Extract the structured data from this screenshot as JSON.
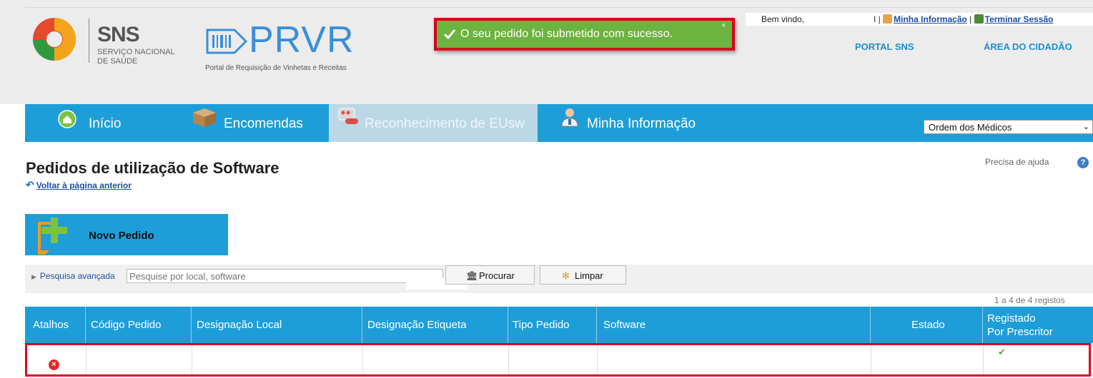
{
  "header": {
    "sns_title": "SNS",
    "sns_sub1": "SERVIÇO NACIONAL",
    "sns_sub2": "DE SAÚDE",
    "prvr_title": "PRVR",
    "prvr_subtitle": "Portal de Requisição de Vinhetas e Receitas",
    "welcome": "Bem vindo,",
    "separator": "I |",
    "my_info_link": "Minha Informação",
    "pipe": "|",
    "logout_link": "Terminar Sessão",
    "portal_sns": "PORTAL SNS",
    "area_cidadao": "ÁREA DO CIDADÃO"
  },
  "toast": {
    "message": "O seu pedido foi submetido com sucesso.",
    "close": "×",
    "success_color": "#6cb33f"
  },
  "nav": {
    "items": [
      {
        "label": "Início",
        "icon": "home-icon"
      },
      {
        "label": "Encomendas",
        "icon": "box-icon"
      },
      {
        "label": "Reconhecimento de EUsw",
        "icon": "pills-icon"
      },
      {
        "label": "Minha Informação",
        "icon": "doctor-icon"
      }
    ],
    "org_select": "Ordem dos Médicos",
    "accent": "#1e9ed8"
  },
  "page": {
    "title": "Pedidos de utilização de Software",
    "back_link": "Voltar à página anterior",
    "help": "Precisa de ajuda",
    "new_button": "Novo Pedido"
  },
  "search": {
    "advanced_link": "Pesquisa avançada",
    "placeholder": "Pesquise por local, software",
    "search_button": "Procurar",
    "clear_button": "Limpar",
    "count": "1 a 4 de 4 registos"
  },
  "table": {
    "headers": {
      "atalhos": "Atalhos",
      "codigo": "Código Pedido",
      "local": "Designação Local",
      "etiqueta": "Designação Etiqueta",
      "tipo": "Tipo Pedido",
      "software": "Software",
      "estado": "Estado",
      "registado1": "Registado",
      "registado2": "Por Prescritor"
    },
    "highlight_color": "#e0001b"
  }
}
